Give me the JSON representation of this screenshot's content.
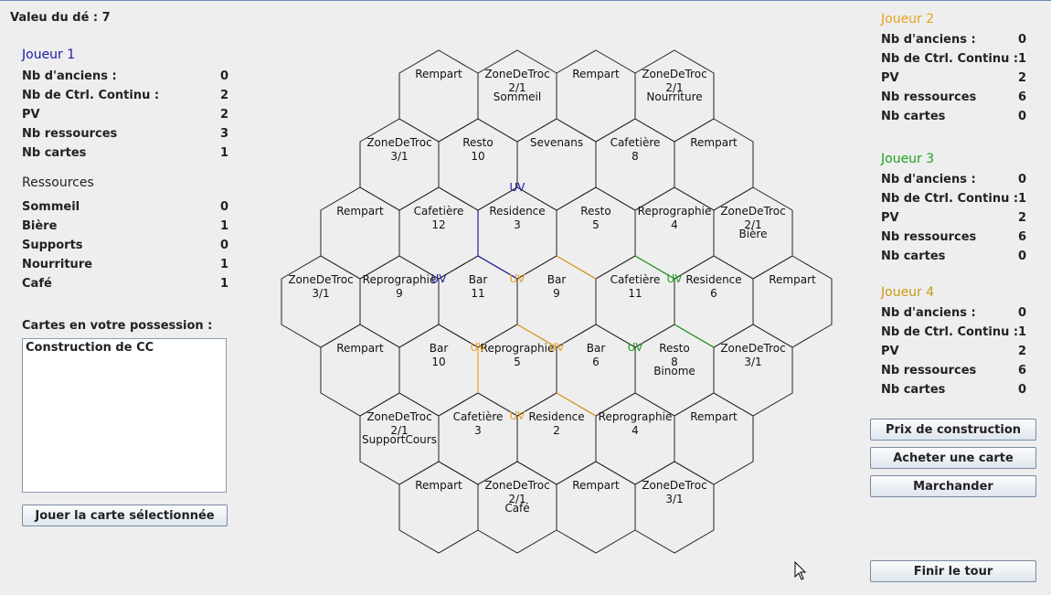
{
  "dice": {
    "label": "Valeu du dé : 7"
  },
  "player1": {
    "name": "Joueur 1",
    "color": "#1a1aa8",
    "stats": [
      {
        "label": "Nb d'anciens :",
        "value": "0"
      },
      {
        "label": "Nb de Ctrl. Continu :",
        "value": "2"
      },
      {
        "label": "PV",
        "value": "2"
      },
      {
        "label": "Nb ressources",
        "value": "3"
      },
      {
        "label": "Nb cartes",
        "value": "1"
      }
    ],
    "resources_title": "Ressources",
    "resources": [
      {
        "label": "Sommeil",
        "value": "0"
      },
      {
        "label": "Bière",
        "value": "1"
      },
      {
        "label": "Supports",
        "value": "0"
      },
      {
        "label": "Nourriture",
        "value": "1"
      },
      {
        "label": "Café",
        "value": "1"
      }
    ],
    "cards_title": "Cartes en votre possession :",
    "cards": [
      "Construction de CC"
    ],
    "play_card_button": "Jouer la carte sélectionnée"
  },
  "opponents": [
    {
      "name": "Joueur 2",
      "color": "#e8a020",
      "stats": [
        {
          "label": "Nb d'anciens :",
          "value": "0"
        },
        {
          "label": "Nb de Ctrl. Continu :",
          "value": "1"
        },
        {
          "label": "PV",
          "value": "2"
        },
        {
          "label": "Nb ressources",
          "value": "6"
        },
        {
          "label": "Nb cartes",
          "value": "0"
        }
      ]
    },
    {
      "name": "Joueur 3",
      "color": "#1ea01e",
      "stats": [
        {
          "label": "Nb d'anciens :",
          "value": "0"
        },
        {
          "label": "Nb de Ctrl. Continu :",
          "value": "1"
        },
        {
          "label": "PV",
          "value": "2"
        },
        {
          "label": "Nb ressources",
          "value": "6"
        },
        {
          "label": "Nb cartes",
          "value": "0"
        }
      ]
    },
    {
      "name": "Joueur 4",
      "color": "#c89a10",
      "stats": [
        {
          "label": "Nb d'anciens :",
          "value": "0"
        },
        {
          "label": "Nb de Ctrl. Continu :",
          "value": "1"
        },
        {
          "label": "PV",
          "value": "2"
        },
        {
          "label": "Nb ressources",
          "value": "6"
        },
        {
          "label": "Nb cartes",
          "value": "0"
        }
      ]
    }
  ],
  "actions": {
    "price": "Prix de construction",
    "buy_card": "Acheter une carte",
    "trade": "Marchander",
    "end_turn": "Finir le tour"
  },
  "board": {
    "rows": [
      [
        {
          "t": "Rempart"
        },
        {
          "t": "ZoneDeTroc",
          "n": "2/1",
          "r": "Sommeil"
        },
        {
          "t": "Rempart"
        },
        {
          "t": "ZoneDeTroc",
          "n": "2/1",
          "r": "Nourriture"
        }
      ],
      [
        {
          "t": "ZoneDeTroc",
          "n": "3/1"
        },
        {
          "t": "Resto",
          "n": "10"
        },
        {
          "t": "Sevenans"
        },
        {
          "t": "Cafetière",
          "n": "8"
        },
        {
          "t": "Rempart"
        }
      ],
      [
        {
          "t": "Rempart"
        },
        {
          "t": "Cafetière",
          "n": "12"
        },
        {
          "t": "Residence",
          "n": "3"
        },
        {
          "t": "Resto",
          "n": "5"
        },
        {
          "t": "Reprographie",
          "n": "4"
        },
        {
          "t": "ZoneDeTroc",
          "n": "2/1",
          "r": "Bière"
        }
      ],
      [
        {
          "t": "ZoneDeTroc",
          "n": "3/1"
        },
        {
          "t": "Reprographie",
          "n": "9"
        },
        {
          "t": "Bar",
          "n": "11"
        },
        {
          "t": "Bar",
          "n": "9"
        },
        {
          "t": "Cafetière",
          "n": "11"
        },
        {
          "t": "Residence",
          "n": "6"
        },
        {
          "t": "Rempart"
        }
      ],
      [
        {
          "t": "Rempart"
        },
        {
          "t": "Bar",
          "n": "10"
        },
        {
          "t": "Reprographie",
          "n": "5"
        },
        {
          "t": "Bar",
          "n": "6"
        },
        {
          "t": "Resto",
          "n": "8",
          "r": "Binome"
        },
        {
          "t": "ZoneDeTroc",
          "n": "3/1"
        }
      ],
      [
        {
          "t": "ZoneDeTroc",
          "n": "2/1",
          "r": "SupportCours"
        },
        {
          "t": "Cafetière",
          "n": "3"
        },
        {
          "t": "Residence",
          "n": "2"
        },
        {
          "t": "Reprographie",
          "n": "4"
        },
        {
          "t": "Rempart"
        }
      ],
      [
        {
          "t": "Rempart"
        },
        {
          "t": "ZoneDeTroc",
          "n": "2/1",
          "r": "Café"
        },
        {
          "t": "Rempart"
        },
        {
          "t": "ZoneDeTroc",
          "n": "3/1"
        }
      ]
    ],
    "uv_label": "UV",
    "uv_markers": [
      {
        "player": 1,
        "row": 2,
        "col": 2,
        "corner": "top"
      },
      {
        "player": 1,
        "row": 3,
        "col": 2,
        "corner": "topleft"
      },
      {
        "player": 2,
        "row": 3,
        "col": 3,
        "corner": "topleft"
      },
      {
        "player": 3,
        "row": 3,
        "col": 5,
        "corner": "topleft"
      },
      {
        "player": 3,
        "row": 4,
        "col": 4,
        "corner": "topleft"
      },
      {
        "player": 2,
        "row": 4,
        "col": 2,
        "corner": "topleft"
      },
      {
        "player": 2,
        "row": 4,
        "col": 2,
        "corner": "topright"
      },
      {
        "player": 2,
        "row": 5,
        "col": 2,
        "corner": "topleft"
      }
    ],
    "roads": [
      {
        "player": 1,
        "row": 2,
        "col": 2,
        "edge": "left"
      },
      {
        "player": 1,
        "row": 3,
        "col": 2,
        "edge": "topright"
      },
      {
        "player": 2,
        "row": 3,
        "col": 3,
        "edge": "topright"
      },
      {
        "player": 3,
        "row": 3,
        "col": 4,
        "edge": "topright"
      },
      {
        "player": 3,
        "row": 3,
        "col": 5,
        "edge": "bottomleft"
      },
      {
        "player": 2,
        "row": 4,
        "col": 2,
        "edge": "left"
      },
      {
        "player": 2,
        "row": 4,
        "col": 2,
        "edge": "topright"
      },
      {
        "player": 2,
        "row": 5,
        "col": 2,
        "edge": "topright"
      }
    ]
  }
}
